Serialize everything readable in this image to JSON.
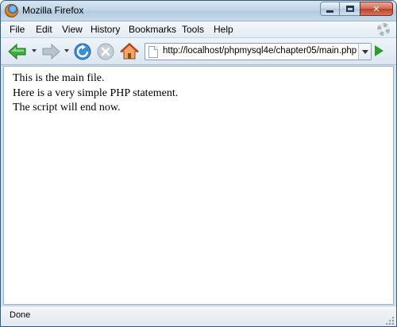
{
  "window": {
    "title": "Mozilla Firefox",
    "close_glyph": "✕"
  },
  "menubar": {
    "items": [
      "File",
      "Edit",
      "View",
      "History",
      "Bookmarks",
      "Tools",
      "Help"
    ]
  },
  "toolbar": {
    "back_icon": "back-arrow-icon",
    "forward_icon": "forward-arrow-icon",
    "reload_icon": "reload-icon",
    "stop_icon": "stop-icon",
    "home_icon": "home-icon",
    "go_icon": "go-arrow-icon"
  },
  "address_bar": {
    "url": "http://localhost/phpmysql4e/chapter05/main.php"
  },
  "page": {
    "lines": [
      "This is the main file.",
      "Here is a very simple PHP statement.",
      "The script will end now."
    ]
  },
  "status_bar": {
    "text": "Done"
  },
  "colors": {
    "back_arrow": "#3fae3f",
    "forward_arrow": "#b8c4ce",
    "reload": "#3a8fd6",
    "stop": "#c7cfd6",
    "go_arrow": "#2f9b2f"
  }
}
